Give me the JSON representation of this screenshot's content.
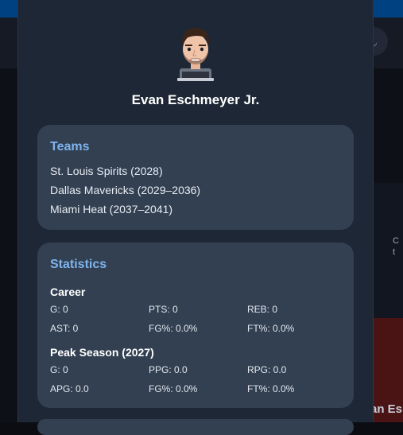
{
  "background": {
    "side_label_1": "C",
    "side_label_2": "t",
    "side_name": "an Es"
  },
  "player": {
    "name": "Evan Eschmeyer Jr."
  },
  "teams": {
    "title": "Teams",
    "items": [
      "St. Louis Spirits (2028)",
      "Dallas Mavericks (2029–2036)",
      "Miami Heat (2037–2041)"
    ]
  },
  "statistics": {
    "title": "Statistics",
    "career": {
      "title": "Career",
      "row1": [
        "G: 0",
        "PTS: 0",
        "REB: 0"
      ],
      "row2": [
        "AST: 0",
        "FG%: 0.0%",
        "FT%: 0.0%"
      ]
    },
    "peak": {
      "title": "Peak Season (2027)",
      "row1": [
        "G: 0",
        "PPG: 0.0",
        "RPG: 0.0"
      ],
      "row2": [
        "APG: 0.0",
        "FG%: 0.0%",
        "FT%: 0.0%"
      ]
    }
  },
  "colors": {
    "top_bar": "#004182",
    "modal": "#1e2735",
    "card": "#324052",
    "accent": "#7fb3ec"
  },
  "icons": {
    "avatar": "player-avatar-icon",
    "header_button": "user-icon"
  }
}
